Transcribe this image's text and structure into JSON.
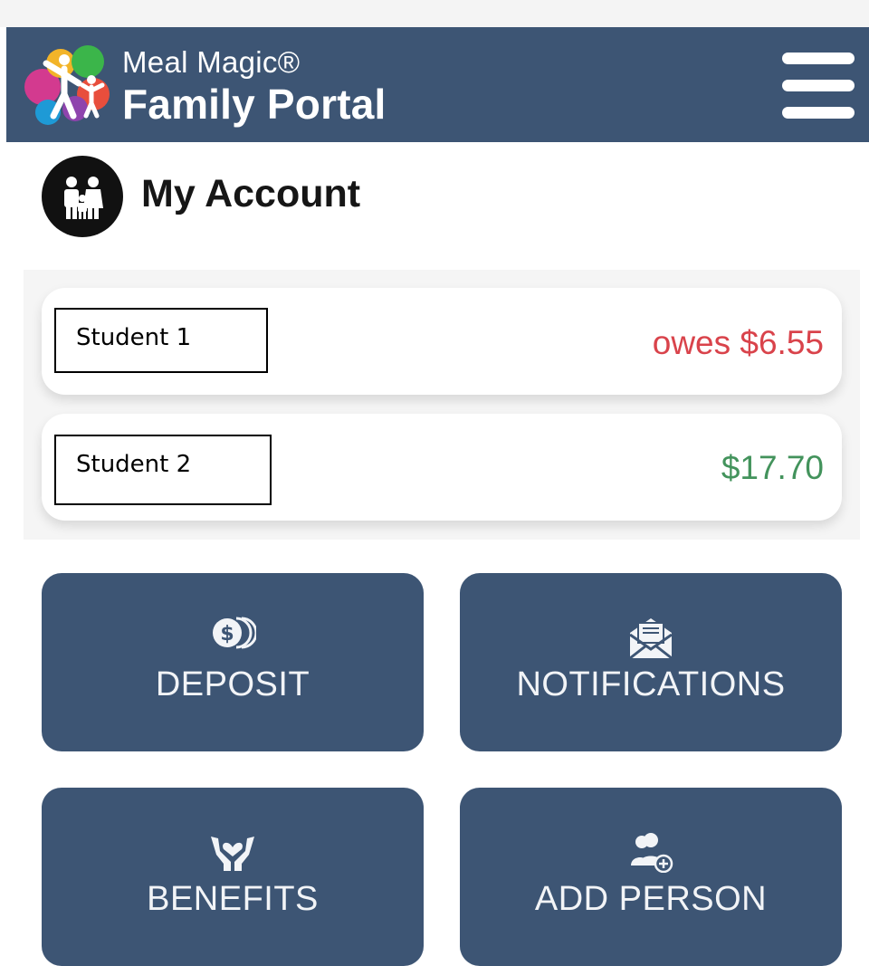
{
  "header": {
    "brand_line1": "Meal Magic®",
    "brand_line2": "Family Portal",
    "background": "#3d5574"
  },
  "account": {
    "title": "My Account"
  },
  "students": [
    {
      "name": "Student 1",
      "amount": "owes $6.55",
      "status_color": "#d9434b"
    },
    {
      "name": "Student 2",
      "amount": "$17.70",
      "status_color": "#43935c"
    }
  ],
  "actions": [
    {
      "label": "DEPOSIT",
      "icon": "coins-icon"
    },
    {
      "label": "NOTIFICATIONS",
      "icon": "envelope-open-icon"
    },
    {
      "label": "BENEFITS",
      "icon": "hands-heart-icon"
    },
    {
      "label": "ADD PERSON",
      "icon": "add-person-icon"
    }
  ]
}
